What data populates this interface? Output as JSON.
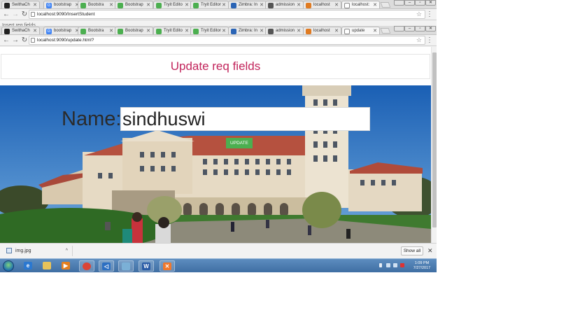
{
  "colors": {
    "title_color": "#c2255c",
    "update_button_bg": "#4caf50",
    "taskbar": "#4a7bb0"
  },
  "back_window": {
    "tabs": [
      {
        "label": "SwithaCh",
        "icon": "github-icon"
      },
      {
        "label": "bootstrap",
        "icon": "google-icon"
      },
      {
        "label": "Bootstra",
        "icon": "w3schools-icon"
      },
      {
        "label": "Bootstrap",
        "icon": "w3schools-icon"
      },
      {
        "label": "Tryit Edito",
        "icon": "w3schools-icon"
      },
      {
        "label": "Tryit Editor",
        "icon": "w3schools-icon"
      },
      {
        "label": "Zimbra: In",
        "icon": "zimbra-icon"
      },
      {
        "label": "admission",
        "icon": "generic-icon"
      },
      {
        "label": "localhost",
        "icon": "chart-icon"
      },
      {
        "label": "localhost:",
        "icon": "page-icon"
      }
    ],
    "url": "localhost:9090/InsertStudent",
    "peek_text": "Insert req fields"
  },
  "front_window": {
    "tabs": [
      {
        "label": "SwithaCh",
        "icon": "github-icon"
      },
      {
        "label": "bootstrap",
        "icon": "google-icon"
      },
      {
        "label": "Bootstra",
        "icon": "w3schools-icon"
      },
      {
        "label": "Bootstrap",
        "icon": "w3schools-icon"
      },
      {
        "label": "Tryit Edito",
        "icon": "w3schools-icon"
      },
      {
        "label": "Tryit Editor",
        "icon": "w3schools-icon"
      },
      {
        "label": "Zimbra: In",
        "icon": "zimbra-icon"
      },
      {
        "label": "admission",
        "icon": "generic-icon"
      },
      {
        "label": "localhost",
        "icon": "chart-icon"
      },
      {
        "label": "update",
        "icon": "page-icon"
      }
    ],
    "url": "localhost:9090/update.html?"
  },
  "page": {
    "title": "Update req fields",
    "name_label": "Name:",
    "name_value": "sindhuswi",
    "update_button": "UPDATE"
  },
  "downloads_bar": {
    "file_name": "img.jpg",
    "show_all": "Show all"
  },
  "taskbar": {
    "apps": [
      "ie-icon",
      "explorer-icon",
      "media-player-icon",
      "chrome-icon",
      "visual-studio-icon",
      "folder-icon",
      "word-icon",
      "xampp-icon"
    ],
    "time": "1:09 PM",
    "date": "7/27/2017"
  }
}
